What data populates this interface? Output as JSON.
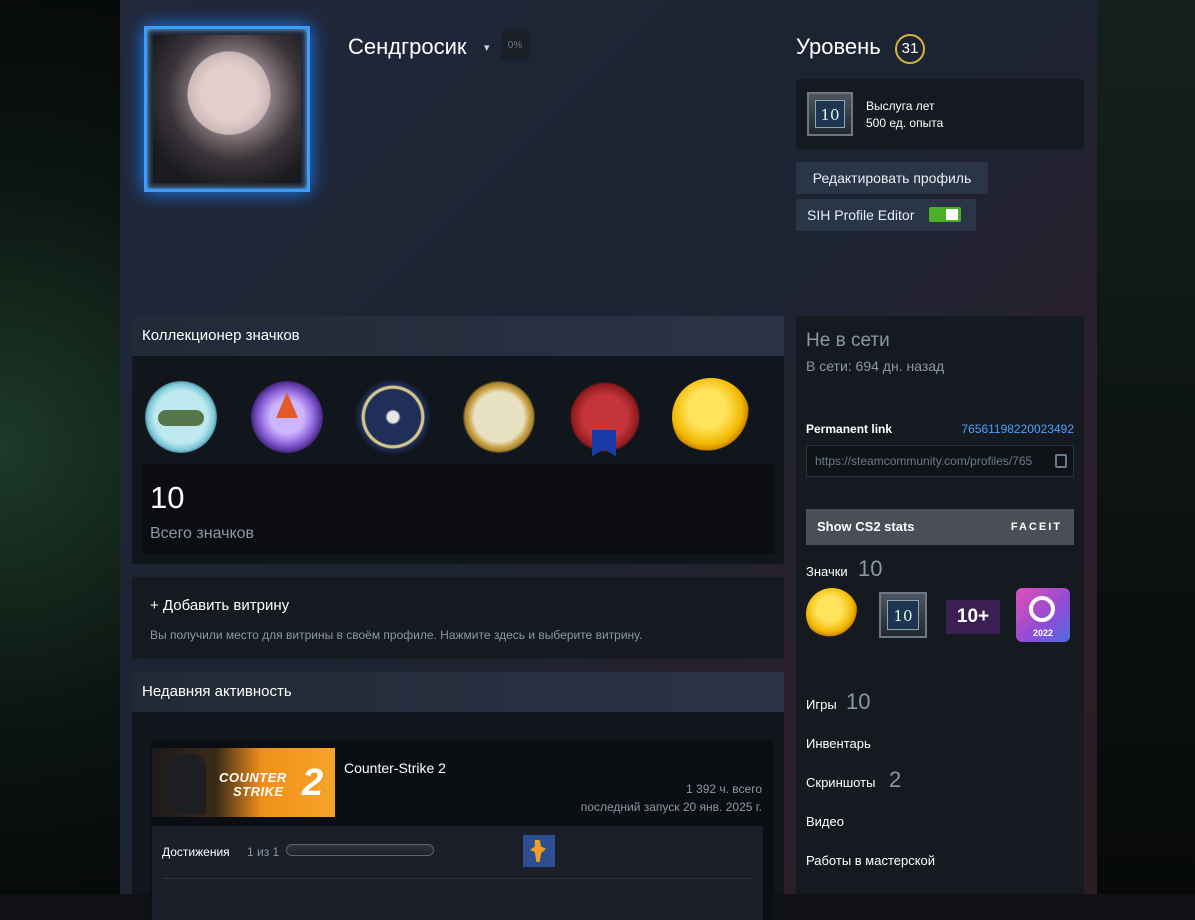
{
  "profile": {
    "persona_name": "Сендгросик",
    "name_caret": "▾",
    "progress_pct": "0%"
  },
  "level": {
    "title": "Уровень",
    "value": "31",
    "badge_number": "10",
    "badge_line1": "Выслуга лет",
    "badge_line2": "500 ед. опыта"
  },
  "buttons": {
    "edit_profile": "Редактировать профиль",
    "sih_editor": "SIH Profile Editor"
  },
  "badge_collector": {
    "title": "Коллекционер значков",
    "total": "10",
    "total_label": "Всего значков"
  },
  "showcase": {
    "title": "+ Добавить витрину",
    "subtitle": "Вы получили место для витрины в своём профиле. Нажмите здесь и выберите витрину."
  },
  "recent_activity": {
    "title": "Недавняя активность",
    "game": {
      "capsule_line1": "COUNTER",
      "capsule_line2": "STRIKE",
      "capsule_num": "2",
      "name": "Counter-Strike 2",
      "hours": "1 392 ч. всего",
      "last_played": "последний запуск 20 янв. 2025 г.",
      "achievements_label": "Достижения",
      "achievements_count": "1 из 1",
      "achievements_progress": 1.0
    }
  },
  "status": {
    "state": "Не в сети",
    "last_online": "В сети: 694 дн. назад"
  },
  "permalink": {
    "label": "Permanent link",
    "id": "76561198220023492",
    "url": "https://steamcommunity.com/profiles/765"
  },
  "cs2": {
    "label": "Show CS2 stats",
    "faceit": "FACEIT"
  },
  "sections": {
    "badges_label": "Значки",
    "badges_count": "10",
    "badge2_number": "10",
    "badge3_label": "10+",
    "badge4_year": "2022",
    "games_label": "Игры",
    "games_count": "10",
    "inventory_label": "Инвентарь",
    "screenshots_label": "Скриншоты",
    "screenshots_count": "2",
    "videos_label": "Видео",
    "workshop_label": "Работы в мастерской"
  },
  "colors": {
    "accent_link": "#4aa3ff",
    "toggle_on": "#4caf2a",
    "level_ring": "#d9b43a",
    "avatar_frame": "#3b9cff"
  }
}
